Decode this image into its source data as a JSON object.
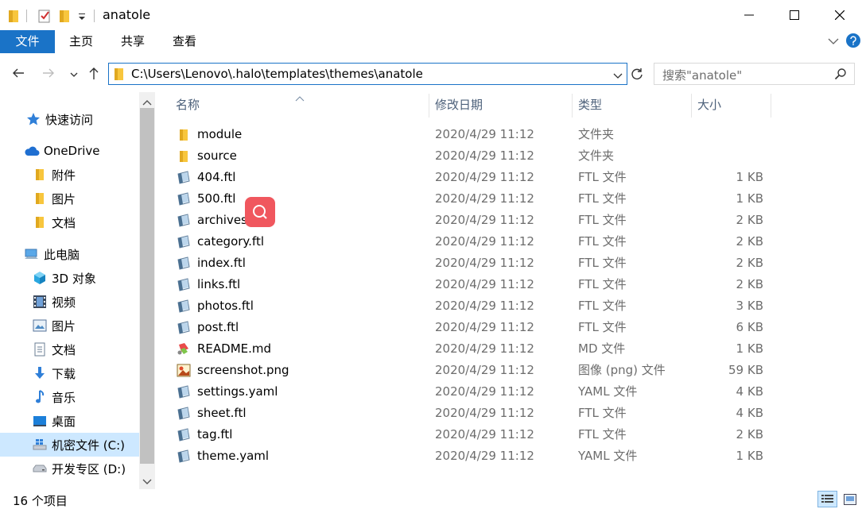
{
  "window": {
    "title": "anatole"
  },
  "ribbon": {
    "tabs": [
      "文件",
      "主页",
      "共享",
      "查看"
    ]
  },
  "address": {
    "path": "C:\\Users\\Lenovo\\.halo\\templates\\themes\\anatole",
    "search_placeholder": "搜索\"anatole\""
  },
  "sidebar": {
    "items": [
      {
        "label": "快速访问",
        "icon": "star-icon"
      },
      {
        "label": "OneDrive",
        "icon": "cloud-icon"
      },
      {
        "label": "附件",
        "icon": "folder-icon"
      },
      {
        "label": "图片",
        "icon": "folder-icon"
      },
      {
        "label": "文档",
        "icon": "folder-icon"
      },
      {
        "label": "此电脑",
        "icon": "computer-icon"
      },
      {
        "label": "3D 对象",
        "icon": "cube-icon"
      },
      {
        "label": "视频",
        "icon": "film-icon"
      },
      {
        "label": "图片",
        "icon": "pictures-icon"
      },
      {
        "label": "文档",
        "icon": "document-icon"
      },
      {
        "label": "下载",
        "icon": "download-icon"
      },
      {
        "label": "音乐",
        "icon": "music-icon"
      },
      {
        "label": "桌面",
        "icon": "desktop-icon"
      },
      {
        "label": "机密文件 (C:)",
        "icon": "windows-drive-icon"
      },
      {
        "label": "开发专区 (D:)",
        "icon": "drive-icon"
      }
    ]
  },
  "columns": {
    "name": "名称",
    "date": "修改日期",
    "type": "类型",
    "size": "大小"
  },
  "files": [
    {
      "name": "module",
      "date": "2020/4/29 11:12",
      "type": "文件夹",
      "size": "",
      "icon": "folder"
    },
    {
      "name": "source",
      "date": "2020/4/29 11:12",
      "type": "文件夹",
      "size": "",
      "icon": "folder"
    },
    {
      "name": "404.ftl",
      "date": "2020/4/29 11:12",
      "type": "FTL 文件",
      "size": "1 KB",
      "icon": "text"
    },
    {
      "name": "500.ftl",
      "date": "2020/4/29 11:12",
      "type": "FTL 文件",
      "size": "1 KB",
      "icon": "text"
    },
    {
      "name": "archives.ftl",
      "date": "2020/4/29 11:12",
      "type": "FTL 文件",
      "size": "2 KB",
      "icon": "text"
    },
    {
      "name": "category.ftl",
      "date": "2020/4/29 11:12",
      "type": "FTL 文件",
      "size": "2 KB",
      "icon": "text"
    },
    {
      "name": "index.ftl",
      "date": "2020/4/29 11:12",
      "type": "FTL 文件",
      "size": "2 KB",
      "icon": "text"
    },
    {
      "name": "links.ftl",
      "date": "2020/4/29 11:12",
      "type": "FTL 文件",
      "size": "2 KB",
      "icon": "text"
    },
    {
      "name": "photos.ftl",
      "date": "2020/4/29 11:12",
      "type": "FTL 文件",
      "size": "3 KB",
      "icon": "text"
    },
    {
      "name": "post.ftl",
      "date": "2020/4/29 11:12",
      "type": "FTL 文件",
      "size": "6 KB",
      "icon": "text"
    },
    {
      "name": "README.md",
      "date": "2020/4/29 11:12",
      "type": "MD 文件",
      "size": "1 KB",
      "icon": "markdown"
    },
    {
      "name": "screenshot.png",
      "date": "2020/4/29 11:12",
      "type": "图像 (png) 文件",
      "size": "59 KB",
      "icon": "image"
    },
    {
      "name": "settings.yaml",
      "date": "2020/4/29 11:12",
      "type": "YAML 文件",
      "size": "4 KB",
      "icon": "text"
    },
    {
      "name": "sheet.ftl",
      "date": "2020/4/29 11:12",
      "type": "FTL 文件",
      "size": "4 KB",
      "icon": "text"
    },
    {
      "name": "tag.ftl",
      "date": "2020/4/29 11:12",
      "type": "FTL 文件",
      "size": "2 KB",
      "icon": "text"
    },
    {
      "name": "theme.yaml",
      "date": "2020/4/29 11:12",
      "type": "YAML 文件",
      "size": "1 KB",
      "icon": "text"
    }
  ],
  "status": {
    "count": "16 个项目"
  },
  "colors": {
    "accent": "#1a73c7",
    "folder": "#f8c63d",
    "selected": "#cde8ff"
  }
}
